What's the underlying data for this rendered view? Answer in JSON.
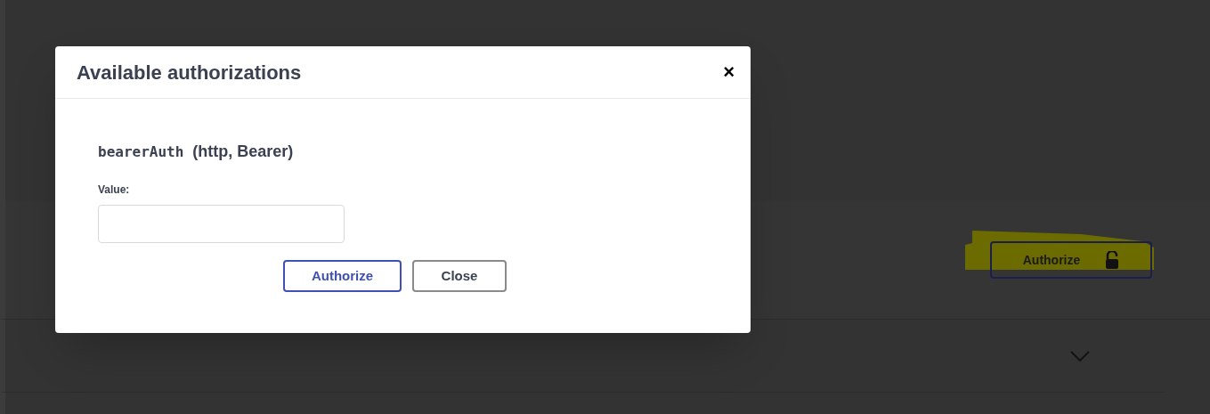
{
  "page": {
    "authorize_button": {
      "label": "Authorize",
      "highlighted": true
    }
  },
  "modal": {
    "title": "Available authorizations",
    "close": "×",
    "scheme": {
      "name": "bearerAuth",
      "type": "(http, Bearer)"
    },
    "field": {
      "label": "Value:"
    },
    "buttons": [
      {
        "label": "Authorize",
        "kind": "primary"
      },
      {
        "label": "Close",
        "kind": "secondary"
      }
    ]
  }
}
